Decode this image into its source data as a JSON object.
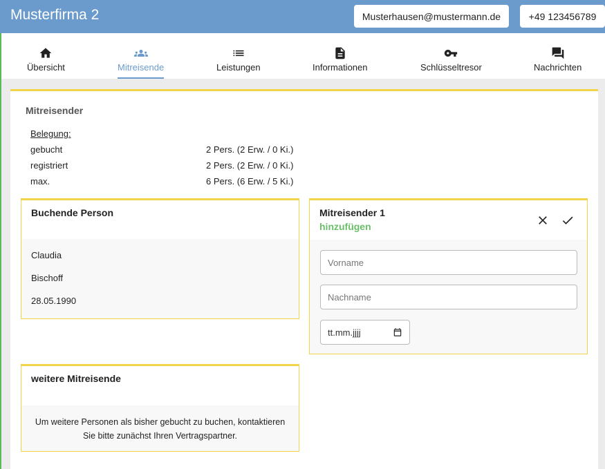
{
  "header": {
    "brand": "Musterfirma 2",
    "email": "Musterhausen@mustermann.de",
    "phone": "+49 123456789"
  },
  "nav": {
    "items": [
      {
        "label": "Übersicht",
        "icon": "home-icon"
      },
      {
        "label": "Mitreisende",
        "icon": "people-icon",
        "active": true
      },
      {
        "label": "Leistungen",
        "icon": "list-icon"
      },
      {
        "label": "Informationen",
        "icon": "document-icon"
      },
      {
        "label": "Schlüsseltresor",
        "icon": "key-icon"
      },
      {
        "label": "Nachrichten",
        "icon": "chat-icon"
      }
    ],
    "accent_color": "#6a9bcc"
  },
  "main": {
    "title": "Mitreisender",
    "belegung": {
      "heading": "Belegung:",
      "rows": [
        {
          "label": "gebucht",
          "value": "2 Pers. (2 Erw. / 0 Ki.)"
        },
        {
          "label": "registriert",
          "value": "2 Pers. (2 Erw. / 0 Ki.)"
        },
        {
          "label": "max.",
          "value": "6 Pers. (6 Erw. / 5 Ki.)"
        }
      ]
    },
    "booking_person": {
      "title": "Buchende Person",
      "first_name": "Claudia",
      "last_name": "Bischoff",
      "birthdate": "28.05.1990"
    },
    "new_traveler": {
      "title": "Mitreisender 1",
      "subtitle": "hinzufügen",
      "subtitle_color": "#6abf69",
      "firstname_placeholder": "Vorname",
      "lastname_placeholder": "Nachname",
      "date_placeholder": "tt.mm.jjjj"
    },
    "more_travelers": {
      "title": "weitere Mitreisende",
      "text": "Um weitere Personen als bisher gebucht zu buchen, kontaktieren Sie bitte zunächst Ihren Vertragspartner."
    },
    "border_color": "#f2d44a"
  }
}
